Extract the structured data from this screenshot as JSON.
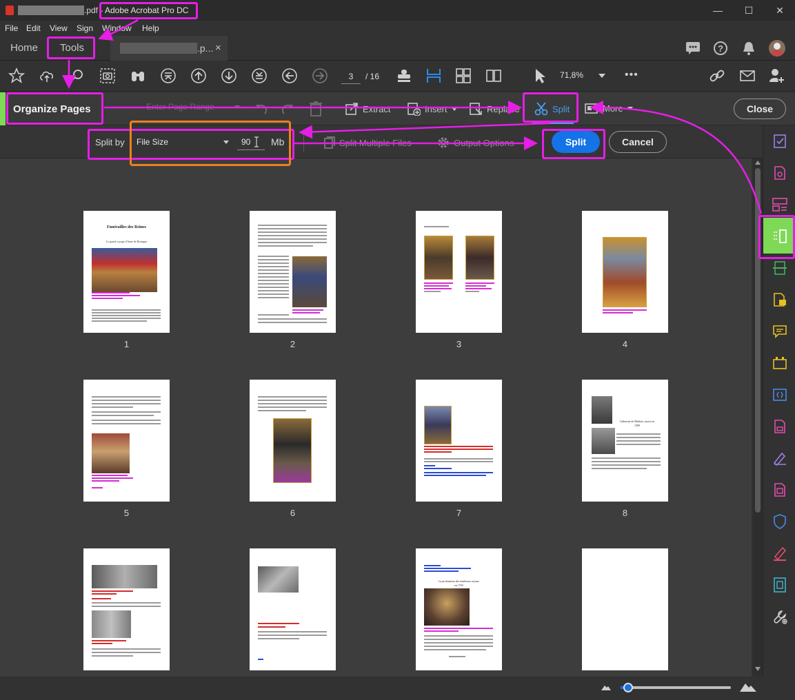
{
  "window": {
    "file_suffix": ".pdf - ",
    "app_name": "Adobe Acrobat Pro DC",
    "minimize": "—",
    "maximize": "☐",
    "close": "✕"
  },
  "menu": [
    "File",
    "Edit",
    "View",
    "Sign",
    "Window",
    "Help"
  ],
  "tabs": {
    "home": "Home",
    "tools": "Tools",
    "document_suffix": ".p...",
    "document_close": "×"
  },
  "toolbar": {
    "current_page": "3",
    "total_pages": "/ 16",
    "zoom": "71,8%",
    "more": "•••"
  },
  "organize": {
    "title": "Organize Pages",
    "page_range_placeholder": "Enter Page Range",
    "extract": "Extract",
    "insert": "Insert",
    "replace": "Replace",
    "split": "Split",
    "more": "More",
    "close": "Close"
  },
  "split_options": {
    "split_by_label": "Split by",
    "split_by_value": "File Size",
    "size_value": "90",
    "unit": "Mb",
    "split_multiple": "Split Multiple Files",
    "output_options": "Output Options",
    "split_button": "Split",
    "cancel_button": "Cancel"
  },
  "thumb_text": {
    "p1_title": "Funérailles des Reines",
    "p1_subtitle": "Le grand voyage d'Anne de Bretagne",
    "p8_title": "Catherine de Médicis, morte en",
    "p8_title2": "1589",
    "p11_title": "La profanation des tombeaux royaux",
    "p11_title2": "en 1793"
  },
  "pages": [
    "1",
    "2",
    "3",
    "4",
    "5",
    "6",
    "7",
    "8"
  ],
  "colors": {
    "accent_blue": "#1473e6",
    "annotation_magenta": "#e61ee6",
    "annotation_orange": "#f0801e",
    "rail_highlight": "#7ed957"
  },
  "icons": {
    "toolbar": [
      "star-icon",
      "cloud-upload-icon",
      "zoom-icon",
      "snapshot-icon",
      "find-icon",
      "first-page-icon",
      "page-up-icon",
      "page-down-icon",
      "last-page-icon",
      "back-icon",
      "forward-icon",
      "stamp-icon",
      "organize-icon",
      "thumbnail-icon",
      "two-page-icon",
      "select-icon"
    ],
    "rail": [
      "fill-sign-icon",
      "export-pdf-icon",
      "edit-pdf-icon",
      "organize-pages-icon",
      "scan-icon",
      "comment-file-icon",
      "comment-icon",
      "stamp-icon",
      "rich-media-icon",
      "protect-icon",
      "sign-icon",
      "redact-icon",
      "video-icon",
      "more-tools-icon"
    ]
  }
}
